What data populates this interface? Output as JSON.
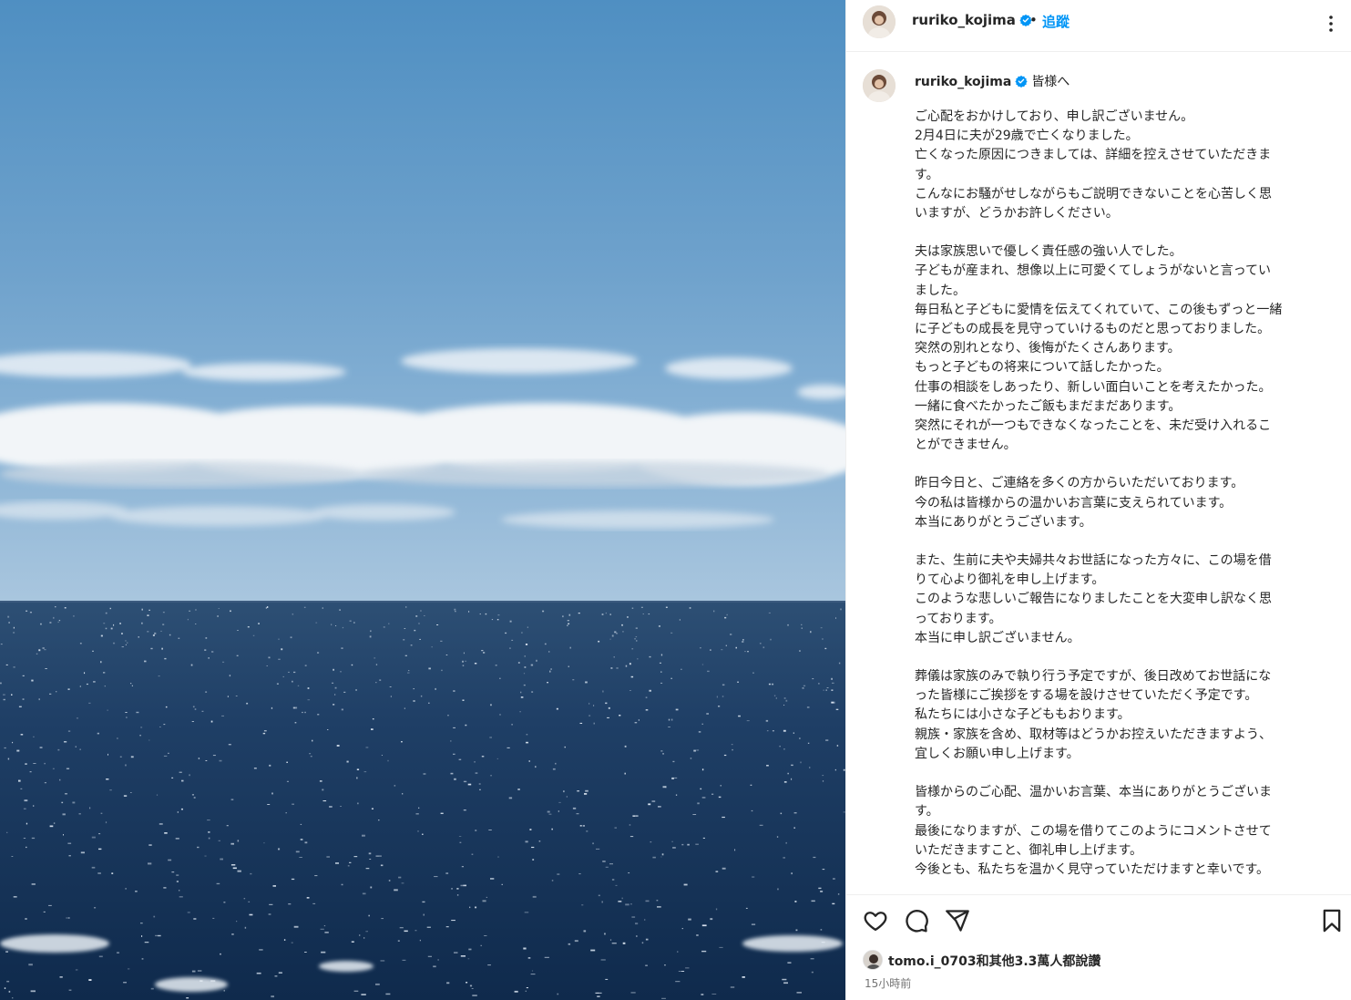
{
  "post": {
    "username": "ruriko_kojima",
    "dot": "•",
    "follow_label": "追蹤",
    "caption_greeting": "皆様へ",
    "caption_paragraphs": [
      [
        "ご心配をおかけしており、申し訳ございません。",
        "2月4日に夫が29歳で亡くなりました。",
        "亡くなった原因につきましては、詳細を控えさせていただきま",
        "す。",
        "こんなにお騒がせしながらもご説明できないことを心苦しく思",
        "いますが、どうかお許しください。"
      ],
      [
        "夫は家族思いで優しく責任感の強い人でした。",
        "子どもが産まれ、想像以上に可愛くてしょうがないと言ってい",
        "ました。",
        "毎日私と子どもに愛情を伝えてくれていて、この後もずっと一緒",
        "に子どもの成長を見守っていけるものだと思っておりました。",
        "突然の別れとなり、後悔がたくさんあります。",
        "もっと子どもの将来について話したかった。",
        "仕事の相談をしあったり、新しい面白いことを考えたかった。",
        "一緒に食べたかったご飯もまだまだあります。",
        "突然にそれが一つもできなくなったことを、未だ受け入れるこ",
        "とができません。"
      ],
      [
        "昨日今日と、ご連絡を多くの方からいただいております。",
        "今の私は皆様からの温かいお言葉に支えられています。",
        "本当にありがとうございます。"
      ],
      [
        "また、生前に夫や夫婦共々お世話になった方々に、この場を借",
        "りて心より御礼を申し上げます。",
        "このような悲しいご報告になりましたことを大変申し訳なく思",
        "っております。",
        "本当に申し訳ございません。"
      ],
      [
        "葬儀は家族のみで執り行う予定ですが、後日改めてお世話にな",
        "った皆様にご挨拶をする場を設けさせていただく予定です。",
        "私たちには小さな子どももおります。",
        "親族・家族を含め、取材等はどうかお控えいただきますよう、",
        "宜しくお願い申し上げます。"
      ],
      [
        "皆様からのご心配、温かいお言葉、本当にありがとうございま",
        "す。",
        "最後になりますが、この場を借りてこのようにコメントさせて",
        "いただきますこと、御礼申し上げます。",
        "今後とも、私たちを温かく見守っていただけますと幸いです。"
      ]
    ],
    "likes_text": "tomo.i_0703和其他3.3萬人都說讚",
    "time_ago": "15小時前"
  },
  "colors": {
    "accent": "#0095f6",
    "verified": "#0095f6",
    "text": "#262626",
    "muted": "#737373"
  },
  "icons": [
    "more-options-icon",
    "verified-badge-icon",
    "heart-icon",
    "comment-icon",
    "share-icon",
    "bookmark-icon"
  ]
}
